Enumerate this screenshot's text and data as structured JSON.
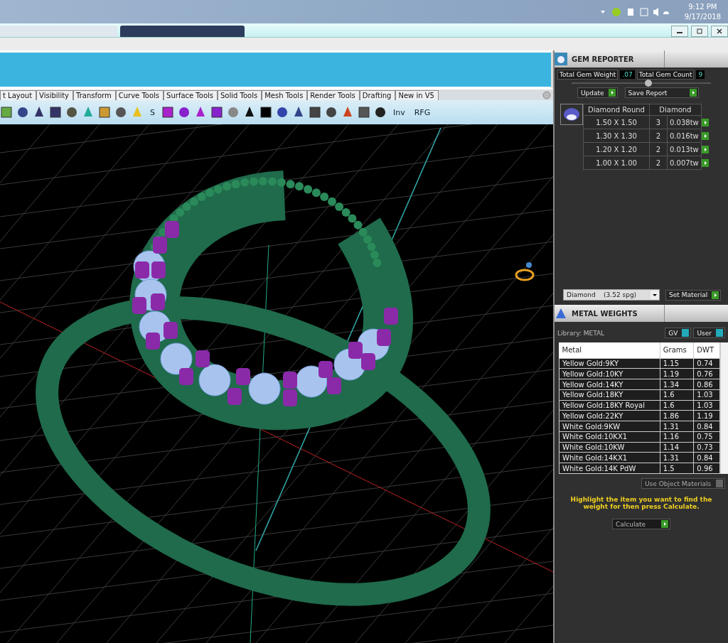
{
  "taskbar": {
    "time": "9:12 PM",
    "date": "9/17/2018"
  },
  "tool_tabs": [
    {
      "label": "t Layout"
    },
    {
      "label": "Visibility"
    },
    {
      "label": "Transform"
    },
    {
      "label": "Curve Tools"
    },
    {
      "label": "Surface Tools"
    },
    {
      "label": "Solid Tools"
    },
    {
      "label": "Mesh Tools"
    },
    {
      "label": "Render Tools"
    },
    {
      "label": "Drafting"
    },
    {
      "label": "New in V5"
    }
  ],
  "toolbar_labels": [
    "S",
    "Inv",
    "RFG"
  ],
  "gem_reporter": {
    "title": "GEM REPORTER",
    "total_weight_label": "Total Gem Weight",
    "total_weight": ".07",
    "total_count_label": "Total Gem Count",
    "total_count": "9",
    "slider": {
      "level": 0.55
    },
    "update": "Update",
    "save_report": "Save Report",
    "columns": [
      "Diamond Round",
      "Diamond"
    ],
    "rows": [
      {
        "size": "1.50 X 1.50",
        "count": "3",
        "weight": "0.038tw"
      },
      {
        "size": "1.30 X 1.30",
        "count": "2",
        "weight": "0.016tw"
      },
      {
        "size": "1.20 X 1.20",
        "count": "2",
        "weight": "0.013tw"
      },
      {
        "size": "1.00 X 1.00",
        "count": "2",
        "weight": "0.007tw"
      }
    ],
    "material": "Diamond    (3.52 spg)",
    "set_material": "Set Material"
  },
  "metal_weights": {
    "title": "METAL WEIGHTS",
    "library": "Library: METAL",
    "gv": "GV",
    "user": "User",
    "columns": [
      "Metal",
      "Grams",
      "DWT"
    ],
    "rows": [
      [
        "Yellow Gold:9KY",
        "1.15",
        "0.74"
      ],
      [
        "Yellow Gold:10KY",
        "1.19",
        "0.76"
      ],
      [
        "Yellow Gold:14KY",
        "1.34",
        "0.86"
      ],
      [
        "Yellow Gold:18KY",
        "1.6",
        "1.03"
      ],
      [
        "Yellow Gold:18KY Royal",
        "1.6",
        "1.03"
      ],
      [
        "Yellow Gold:22KY",
        "1.86",
        "1.19"
      ],
      [
        "White Gold:9KW",
        "1.31",
        "0.84"
      ],
      [
        "White Gold:10KX1",
        "1.16",
        "0.75"
      ],
      [
        "White Gold:10KW",
        "1.14",
        "0.73"
      ],
      [
        "White Gold:14KX1",
        "1.31",
        "0.84"
      ],
      [
        "White Gold:14K PdW",
        "1.5",
        "0.96"
      ]
    ],
    "use_object_materials": "Use Object Materials",
    "hint": "Highlight the item you want to find the weight for then press Calculate.",
    "calculate": "Calculate"
  }
}
